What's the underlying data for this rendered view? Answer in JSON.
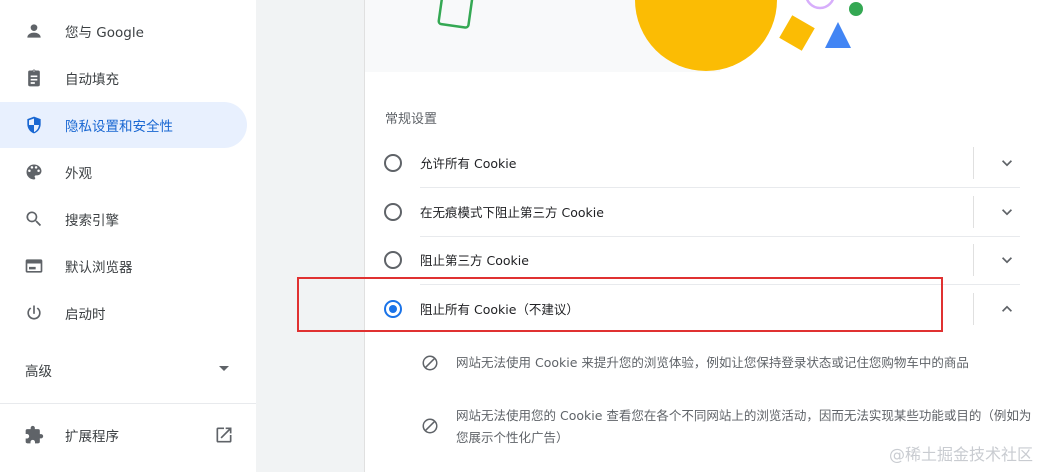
{
  "sidebar": {
    "items": [
      {
        "label": "您与 Google",
        "icon": "person-icon",
        "active": false
      },
      {
        "label": "自动填充",
        "icon": "clipboard-icon",
        "active": false
      },
      {
        "label": "隐私设置和安全性",
        "icon": "shield-icon",
        "active": true
      },
      {
        "label": "外观",
        "icon": "palette-icon",
        "active": false
      },
      {
        "label": "搜索引擎",
        "icon": "search-icon",
        "active": false
      },
      {
        "label": "默认浏览器",
        "icon": "browser-icon",
        "active": false
      },
      {
        "label": "启动时",
        "icon": "power-icon",
        "active": false
      }
    ],
    "advanced_label": "高级",
    "extensions_label": "扩展程序"
  },
  "main": {
    "section_title": "常规设置",
    "options": [
      {
        "label": "允许所有 Cookie",
        "selected": false,
        "expanded": false
      },
      {
        "label": "在无痕模式下阻止第三方 Cookie",
        "selected": false,
        "expanded": false
      },
      {
        "label": "阻止第三方 Cookie",
        "selected": false,
        "expanded": false
      },
      {
        "label": "阻止所有 Cookie（不建议）",
        "selected": true,
        "expanded": true
      }
    ],
    "details": [
      "网站无法使用 Cookie 来提升您的浏览体验，例如让您保持登录状态或记住您购物车中的商品",
      "网站无法使用您的 Cookie 查看您在各个不同网站上的浏览活动，因而无法实现某些功能或目的（例如为您展示个性化广告）"
    ]
  },
  "watermark": "@稀土掘金技术社区",
  "colors": {
    "accent": "#1a73e8",
    "active_bg": "#e8f0fe",
    "highlight_box": "#e03131"
  }
}
